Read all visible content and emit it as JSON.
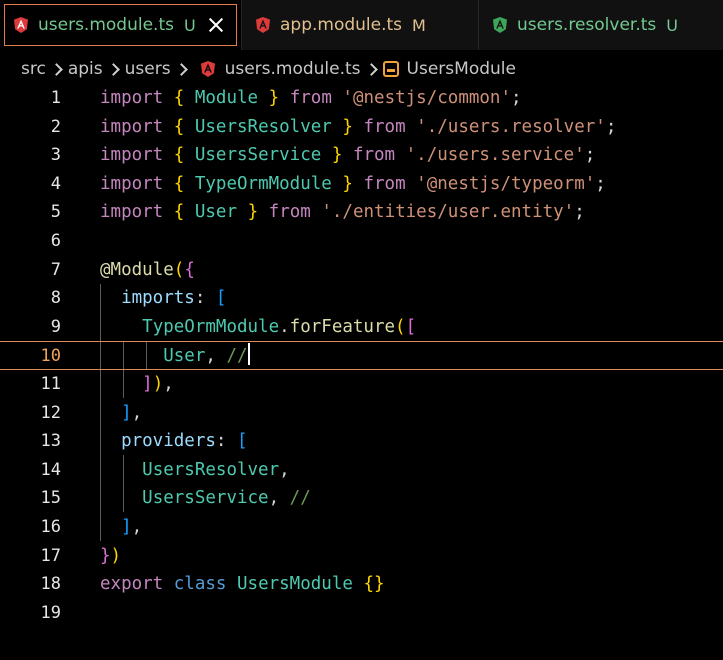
{
  "tabs": [
    {
      "label": "users.module.ts",
      "status": "U",
      "active": true,
      "icon": "angular-icon"
    },
    {
      "label": "app.module.ts",
      "status": "M",
      "active": false,
      "icon": "angular-icon"
    },
    {
      "label": "users.resolver.ts",
      "status": "U",
      "active": false,
      "icon": "angular-resolver-icon"
    }
  ],
  "breadcrumb": {
    "parts": [
      "src",
      "apis",
      "users"
    ],
    "file": "users.module.ts",
    "symbol": "UsersModule"
  },
  "editor": {
    "current_line": 10,
    "lines": [
      {
        "n": "1",
        "tokens": [
          [
            "kw",
            "import"
          ],
          [
            "pun",
            " "
          ],
          [
            "br1",
            "{"
          ],
          [
            "pun",
            " "
          ],
          [
            "cls",
            "Module"
          ],
          [
            "pun",
            " "
          ],
          [
            "br1",
            "}"
          ],
          [
            "pun",
            " "
          ],
          [
            "kw",
            "from"
          ],
          [
            "pun",
            " "
          ],
          [
            "str",
            "'@nestjs/common'"
          ],
          [
            "pun",
            ";"
          ]
        ]
      },
      {
        "n": "2",
        "tokens": [
          [
            "kw",
            "import"
          ],
          [
            "pun",
            " "
          ],
          [
            "br1",
            "{"
          ],
          [
            "pun",
            " "
          ],
          [
            "cls",
            "UsersResolver"
          ],
          [
            "pun",
            " "
          ],
          [
            "br1",
            "}"
          ],
          [
            "pun",
            " "
          ],
          [
            "kw",
            "from"
          ],
          [
            "pun",
            " "
          ],
          [
            "str",
            "'./users.resolver'"
          ],
          [
            "pun",
            ";"
          ]
        ]
      },
      {
        "n": "3",
        "tokens": [
          [
            "kw",
            "import"
          ],
          [
            "pun",
            " "
          ],
          [
            "br1",
            "{"
          ],
          [
            "pun",
            " "
          ],
          [
            "cls",
            "UsersService"
          ],
          [
            "pun",
            " "
          ],
          [
            "br1",
            "}"
          ],
          [
            "pun",
            " "
          ],
          [
            "kw",
            "from"
          ],
          [
            "pun",
            " "
          ],
          [
            "str",
            "'./users.service'"
          ],
          [
            "pun",
            ";"
          ]
        ]
      },
      {
        "n": "4",
        "tokens": [
          [
            "kw",
            "import"
          ],
          [
            "pun",
            " "
          ],
          [
            "br1",
            "{"
          ],
          [
            "pun",
            " "
          ],
          [
            "cls",
            "TypeOrmModule"
          ],
          [
            "pun",
            " "
          ],
          [
            "br1",
            "}"
          ],
          [
            "pun",
            " "
          ],
          [
            "kw",
            "from"
          ],
          [
            "pun",
            " "
          ],
          [
            "str",
            "'@nestjs/typeorm'"
          ],
          [
            "pun",
            ";"
          ]
        ]
      },
      {
        "n": "5",
        "tokens": [
          [
            "kw",
            "import"
          ],
          [
            "pun",
            " "
          ],
          [
            "br1",
            "{"
          ],
          [
            "pun",
            " "
          ],
          [
            "cls",
            "User"
          ],
          [
            "pun",
            " "
          ],
          [
            "br1",
            "}"
          ],
          [
            "pun",
            " "
          ],
          [
            "kw",
            "from"
          ],
          [
            "pun",
            " "
          ],
          [
            "str",
            "'./entities/user.entity'"
          ],
          [
            "pun",
            ";"
          ]
        ]
      },
      {
        "n": "6",
        "tokens": []
      },
      {
        "n": "7",
        "tokens": [
          [
            "dec",
            "@"
          ],
          [
            "fn",
            "Module"
          ],
          [
            "br1",
            "("
          ],
          [
            "br2",
            "{"
          ]
        ]
      },
      {
        "n": "8",
        "tokens": [
          [
            "pun",
            "  "
          ],
          [
            "prop",
            "imports"
          ],
          [
            "pun",
            ": "
          ],
          [
            "br3",
            "["
          ]
        ]
      },
      {
        "n": "9",
        "tokens": [
          [
            "pun",
            "    "
          ],
          [
            "cls",
            "TypeOrmModule"
          ],
          [
            "pun",
            "."
          ],
          [
            "fn",
            "forFeature"
          ],
          [
            "br1",
            "("
          ],
          [
            "br2",
            "["
          ]
        ]
      },
      {
        "n": "10",
        "tokens": [
          [
            "pun",
            "      "
          ],
          [
            "cls",
            "User"
          ],
          [
            "pun",
            ", "
          ],
          [
            "cm",
            "//"
          ]
        ]
      },
      {
        "n": "11",
        "tokens": [
          [
            "pun",
            "    "
          ],
          [
            "br2",
            "]"
          ],
          [
            "br1",
            ")"
          ],
          [
            "pun",
            ","
          ]
        ]
      },
      {
        "n": "12",
        "tokens": [
          [
            "pun",
            "  "
          ],
          [
            "br3",
            "]"
          ],
          [
            "pun",
            ","
          ]
        ]
      },
      {
        "n": "13",
        "tokens": [
          [
            "pun",
            "  "
          ],
          [
            "prop",
            "providers"
          ],
          [
            "pun",
            ": "
          ],
          [
            "br3",
            "["
          ]
        ]
      },
      {
        "n": "14",
        "tokens": [
          [
            "pun",
            "    "
          ],
          [
            "cls",
            "UsersResolver"
          ],
          [
            "pun",
            ","
          ]
        ]
      },
      {
        "n": "15",
        "tokens": [
          [
            "pun",
            "    "
          ],
          [
            "cls",
            "UsersService"
          ],
          [
            "pun",
            ", "
          ],
          [
            "cm",
            "//"
          ]
        ]
      },
      {
        "n": "16",
        "tokens": [
          [
            "pun",
            "  "
          ],
          [
            "br3",
            "]"
          ],
          [
            "pun",
            ","
          ]
        ]
      },
      {
        "n": "17",
        "tokens": [
          [
            "br2",
            "}"
          ],
          [
            "br1",
            ")"
          ]
        ]
      },
      {
        "n": "18",
        "tokens": [
          [
            "kw",
            "export"
          ],
          [
            "pun",
            " "
          ],
          [
            "kw2",
            "class"
          ],
          [
            "pun",
            " "
          ],
          [
            "cls",
            "UsersModule"
          ],
          [
            "pun",
            " "
          ],
          [
            "br1",
            "{}"
          ]
        ]
      },
      {
        "n": "19",
        "tokens": []
      }
    ]
  },
  "colors": {
    "tab_active_border": "#e37b4f",
    "angular_red": "#dd3b3b",
    "resolver_green": "#3fa55a",
    "status_untracked": "#73c991",
    "status_modified": "#e2c08d"
  }
}
